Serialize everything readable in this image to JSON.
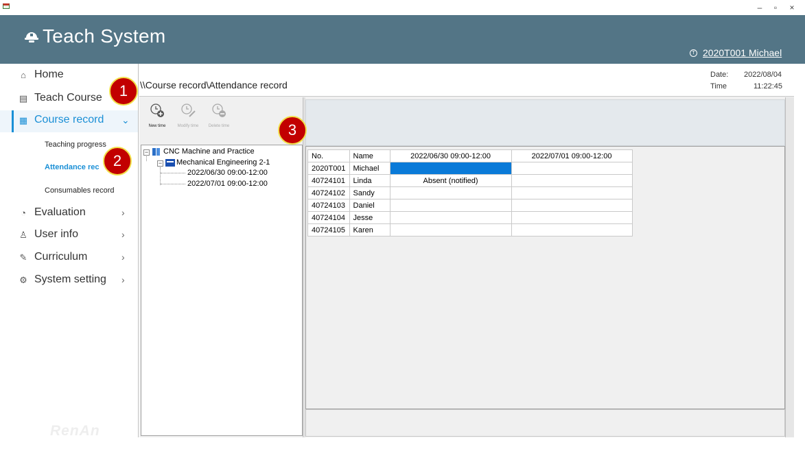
{
  "window": {
    "minimize": "–",
    "maximize": "▫",
    "close": "×"
  },
  "header": {
    "title": "Teach System",
    "user": "2020T001 Michael",
    "user_icon": "T"
  },
  "sidebar": {
    "items": [
      {
        "label": "Home",
        "icon": "⌂"
      },
      {
        "label": "Teach Course",
        "icon": "▤"
      },
      {
        "label": "Course record",
        "icon": "▦",
        "arrow": "⌄"
      },
      {
        "label": "Evaluation",
        "icon": "◔",
        "arrow": "›"
      },
      {
        "label": "User info",
        "icon": "♙",
        "arrow": "›"
      },
      {
        "label": "Curriculum",
        "icon": "✎",
        "arrow": "›"
      },
      {
        "label": "System setting",
        "icon": "⚙",
        "arrow": "›"
      }
    ],
    "sub_items": [
      "Teaching progress",
      "Attendance rec",
      "Consumables record"
    ],
    "watermark": "RenAn"
  },
  "content": {
    "breadcrumb": "\\\\Course record\\Attendance record",
    "date_label": "Date:",
    "date_value": "2022/08/04",
    "time_label": "Time",
    "time_value": "11:22:45"
  },
  "toolbar": {
    "new_time": "New time",
    "modify_time": "Modify time",
    "delete_time": "Delete time"
  },
  "tree": {
    "course": "CNC Machine and Practice",
    "class": "Mechanical Engineering 2-1",
    "sessions": [
      "2022/06/30 09:00-12:00",
      "2022/07/01 09:00-12:00"
    ]
  },
  "grid": {
    "headers": [
      "No.",
      "Name",
      "2022/06/30 09:00-12:00",
      "2022/07/01 09:00-12:00"
    ],
    "rows": [
      [
        "2020T001",
        "Michael",
        "",
        ""
      ],
      [
        "40724101",
        "Linda",
        "Absent (notified)",
        ""
      ],
      [
        "40724102",
        "Sandy",
        "",
        ""
      ],
      [
        "40724103",
        "Daniel",
        "",
        ""
      ],
      [
        "40724104",
        "Jesse",
        "",
        ""
      ],
      [
        "40724105",
        "Karen",
        "",
        ""
      ]
    ]
  },
  "badges": [
    "1",
    "2",
    "3"
  ],
  "colors": {
    "header": "#537586",
    "accent": "#1a8fd6",
    "badge": "#c20000",
    "selection": "#0a7ad8"
  }
}
